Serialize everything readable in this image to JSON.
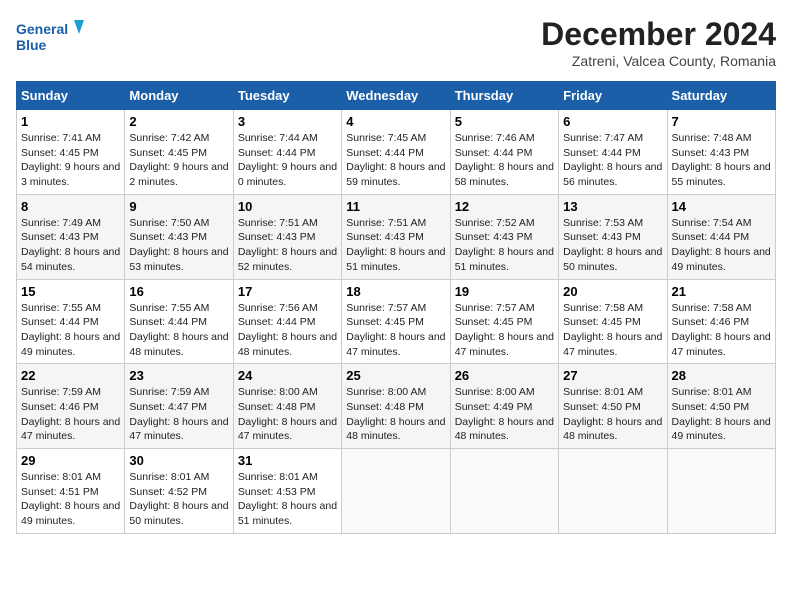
{
  "header": {
    "logo_line1": "General",
    "logo_line2": "Blue",
    "month": "December 2024",
    "location": "Zatreni, Valcea County, Romania"
  },
  "weekdays": [
    "Sunday",
    "Monday",
    "Tuesday",
    "Wednesday",
    "Thursday",
    "Friday",
    "Saturday"
  ],
  "weeks": [
    [
      {
        "day": "1",
        "sunrise": "7:41 AM",
        "sunset": "4:45 PM",
        "daylight": "9 hours and 3 minutes."
      },
      {
        "day": "2",
        "sunrise": "7:42 AM",
        "sunset": "4:45 PM",
        "daylight": "9 hours and 2 minutes."
      },
      {
        "day": "3",
        "sunrise": "7:44 AM",
        "sunset": "4:44 PM",
        "daylight": "9 hours and 0 minutes."
      },
      {
        "day": "4",
        "sunrise": "7:45 AM",
        "sunset": "4:44 PM",
        "daylight": "8 hours and 59 minutes."
      },
      {
        "day": "5",
        "sunrise": "7:46 AM",
        "sunset": "4:44 PM",
        "daylight": "8 hours and 58 minutes."
      },
      {
        "day": "6",
        "sunrise": "7:47 AM",
        "sunset": "4:44 PM",
        "daylight": "8 hours and 56 minutes."
      },
      {
        "day": "7",
        "sunrise": "7:48 AM",
        "sunset": "4:43 PM",
        "daylight": "8 hours and 55 minutes."
      }
    ],
    [
      {
        "day": "8",
        "sunrise": "7:49 AM",
        "sunset": "4:43 PM",
        "daylight": "8 hours and 54 minutes."
      },
      {
        "day": "9",
        "sunrise": "7:50 AM",
        "sunset": "4:43 PM",
        "daylight": "8 hours and 53 minutes."
      },
      {
        "day": "10",
        "sunrise": "7:51 AM",
        "sunset": "4:43 PM",
        "daylight": "8 hours and 52 minutes."
      },
      {
        "day": "11",
        "sunrise": "7:51 AM",
        "sunset": "4:43 PM",
        "daylight": "8 hours and 51 minutes."
      },
      {
        "day": "12",
        "sunrise": "7:52 AM",
        "sunset": "4:43 PM",
        "daylight": "8 hours and 51 minutes."
      },
      {
        "day": "13",
        "sunrise": "7:53 AM",
        "sunset": "4:43 PM",
        "daylight": "8 hours and 50 minutes."
      },
      {
        "day": "14",
        "sunrise": "7:54 AM",
        "sunset": "4:44 PM",
        "daylight": "8 hours and 49 minutes."
      }
    ],
    [
      {
        "day": "15",
        "sunrise": "7:55 AM",
        "sunset": "4:44 PM",
        "daylight": "8 hours and 49 minutes."
      },
      {
        "day": "16",
        "sunrise": "7:55 AM",
        "sunset": "4:44 PM",
        "daylight": "8 hours and 48 minutes."
      },
      {
        "day": "17",
        "sunrise": "7:56 AM",
        "sunset": "4:44 PM",
        "daylight": "8 hours and 48 minutes."
      },
      {
        "day": "18",
        "sunrise": "7:57 AM",
        "sunset": "4:45 PM",
        "daylight": "8 hours and 47 minutes."
      },
      {
        "day": "19",
        "sunrise": "7:57 AM",
        "sunset": "4:45 PM",
        "daylight": "8 hours and 47 minutes."
      },
      {
        "day": "20",
        "sunrise": "7:58 AM",
        "sunset": "4:45 PM",
        "daylight": "8 hours and 47 minutes."
      },
      {
        "day": "21",
        "sunrise": "7:58 AM",
        "sunset": "4:46 PM",
        "daylight": "8 hours and 47 minutes."
      }
    ],
    [
      {
        "day": "22",
        "sunrise": "7:59 AM",
        "sunset": "4:46 PM",
        "daylight": "8 hours and 47 minutes."
      },
      {
        "day": "23",
        "sunrise": "7:59 AM",
        "sunset": "4:47 PM",
        "daylight": "8 hours and 47 minutes."
      },
      {
        "day": "24",
        "sunrise": "8:00 AM",
        "sunset": "4:48 PM",
        "daylight": "8 hours and 47 minutes."
      },
      {
        "day": "25",
        "sunrise": "8:00 AM",
        "sunset": "4:48 PM",
        "daylight": "8 hours and 48 minutes."
      },
      {
        "day": "26",
        "sunrise": "8:00 AM",
        "sunset": "4:49 PM",
        "daylight": "8 hours and 48 minutes."
      },
      {
        "day": "27",
        "sunrise": "8:01 AM",
        "sunset": "4:50 PM",
        "daylight": "8 hours and 48 minutes."
      },
      {
        "day": "28",
        "sunrise": "8:01 AM",
        "sunset": "4:50 PM",
        "daylight": "8 hours and 49 minutes."
      }
    ],
    [
      {
        "day": "29",
        "sunrise": "8:01 AM",
        "sunset": "4:51 PM",
        "daylight": "8 hours and 49 minutes."
      },
      {
        "day": "30",
        "sunrise": "8:01 AM",
        "sunset": "4:52 PM",
        "daylight": "8 hours and 50 minutes."
      },
      {
        "day": "31",
        "sunrise": "8:01 AM",
        "sunset": "4:53 PM",
        "daylight": "8 hours and 51 minutes."
      },
      null,
      null,
      null,
      null
    ]
  ]
}
